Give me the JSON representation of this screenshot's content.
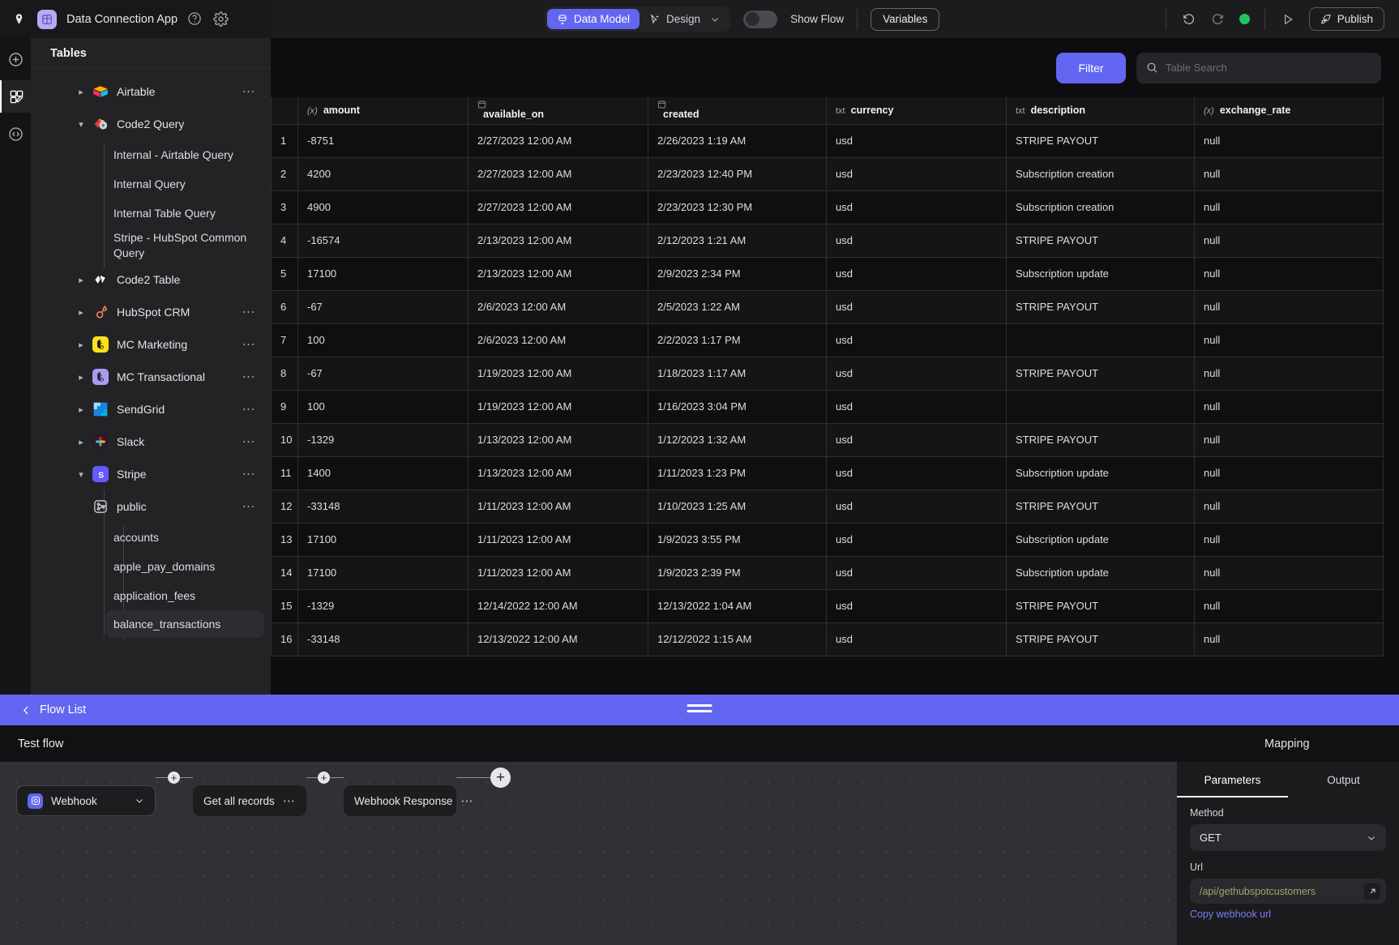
{
  "topbar": {
    "home_icon": "home-icon",
    "app_title": "Data Connection App",
    "help_icon": "help-circle-icon",
    "settings_icon": "gear-icon",
    "segment": {
      "data_model": "Data Model",
      "design": "Design",
      "caret": "chevron-down-icon"
    },
    "show_flow_label": "Show Flow",
    "show_flow_on": false,
    "variables_label": "Variables",
    "undo_icon": "undo-icon",
    "redo_icon": "redo-icon",
    "status_dot_color": "#22c55e",
    "play_icon": "play-icon",
    "publish_label": "Publish",
    "publish_icon": "rocket-icon"
  },
  "rail": {
    "items": [
      {
        "name": "add-icon"
      },
      {
        "name": "tables-edit-icon"
      },
      {
        "name": "code-icon"
      }
    ]
  },
  "sidebar": {
    "header": "Tables",
    "items": [
      {
        "label": "Airtable",
        "icon": "airtable-icon",
        "expanded": false,
        "dots": true
      },
      {
        "label": "Code2 Query",
        "icon": "code2-query-icon",
        "expanded": true,
        "dots": false,
        "children": [
          "Internal - Airtable Query",
          "Internal Query",
          "Internal Table Query",
          "Stripe - HubSpot Common Query"
        ]
      },
      {
        "label": "Code2 Table",
        "icon": "code2-table-icon",
        "expanded": false,
        "dots": false
      },
      {
        "label": "HubSpot CRM",
        "icon": "hubspot-icon",
        "expanded": false,
        "dots": true
      },
      {
        "label": "MC Marketing",
        "icon": "mailchimp-marketing-icon",
        "expanded": false,
        "dots": true
      },
      {
        "label": "MC Transactional",
        "icon": "mailchimp-transactional-icon",
        "expanded": false,
        "dots": true
      },
      {
        "label": "SendGrid",
        "icon": "sendgrid-icon",
        "expanded": false,
        "dots": true
      },
      {
        "label": "Slack",
        "icon": "slack-icon",
        "expanded": false,
        "dots": true
      },
      {
        "label": "Stripe",
        "icon": "stripe-icon",
        "expanded": true,
        "dots": true
      }
    ],
    "stripe_schema": {
      "label": "public",
      "icon": "schema-icon",
      "expanded": true,
      "dots": true
    },
    "stripe_tables": [
      "accounts",
      "apple_pay_domains",
      "application_fees",
      "balance_transactions"
    ],
    "selected_table": "balance_transactions"
  },
  "toolbar": {
    "filter_label": "Filter",
    "search_placeholder": "Table Search",
    "search_value": "",
    "search_icon": "search-icon"
  },
  "table": {
    "columns": [
      {
        "name": "amount",
        "type": "(x)",
        "type_kind": "number"
      },
      {
        "name": "available_on",
        "type": "date",
        "type_kind": "date"
      },
      {
        "name": "created",
        "type": "date",
        "type_kind": "date"
      },
      {
        "name": "currency",
        "type": "txt",
        "type_kind": "text"
      },
      {
        "name": "description",
        "type": "txt",
        "type_kind": "text"
      },
      {
        "name": "exchange_rate",
        "type": "(x)",
        "type_kind": "number"
      }
    ],
    "rows": [
      {
        "idx": "1",
        "amount": "-8751",
        "available_on": "2/27/2023 12:00 AM",
        "created": "2/26/2023 1:19 AM",
        "currency": "usd",
        "description": "STRIPE PAYOUT",
        "exchange_rate": "null"
      },
      {
        "idx": "2",
        "amount": "4200",
        "available_on": "2/27/2023 12:00 AM",
        "created": "2/23/2023 12:40 PM",
        "currency": "usd",
        "description": "Subscription creation",
        "exchange_rate": "null"
      },
      {
        "idx": "3",
        "amount": "4900",
        "available_on": "2/27/2023 12:00 AM",
        "created": "2/23/2023 12:30 PM",
        "currency": "usd",
        "description": "Subscription creation",
        "exchange_rate": "null"
      },
      {
        "idx": "4",
        "amount": "-16574",
        "available_on": "2/13/2023 12:00 AM",
        "created": "2/12/2023 1:21 AM",
        "currency": "usd",
        "description": "STRIPE PAYOUT",
        "exchange_rate": "null"
      },
      {
        "idx": "5",
        "amount": "17100",
        "available_on": "2/13/2023 12:00 AM",
        "created": "2/9/2023 2:34 PM",
        "currency": "usd",
        "description": "Subscription update",
        "exchange_rate": "null"
      },
      {
        "idx": "6",
        "amount": "-67",
        "available_on": "2/6/2023 12:00 AM",
        "created": "2/5/2023 1:22 AM",
        "currency": "usd",
        "description": "STRIPE PAYOUT",
        "exchange_rate": "null"
      },
      {
        "idx": "7",
        "amount": "100",
        "available_on": "2/6/2023 12:00 AM",
        "created": "2/2/2023 1:17 PM",
        "currency": "usd",
        "description": "",
        "exchange_rate": "null"
      },
      {
        "idx": "8",
        "amount": "-67",
        "available_on": "1/19/2023 12:00 AM",
        "created": "1/18/2023 1:17 AM",
        "currency": "usd",
        "description": "STRIPE PAYOUT",
        "exchange_rate": "null"
      },
      {
        "idx": "9",
        "amount": "100",
        "available_on": "1/19/2023 12:00 AM",
        "created": "1/16/2023 3:04 PM",
        "currency": "usd",
        "description": "",
        "exchange_rate": "null"
      },
      {
        "idx": "10",
        "amount": "-1329",
        "available_on": "1/13/2023 12:00 AM",
        "created": "1/12/2023 1:32 AM",
        "currency": "usd",
        "description": "STRIPE PAYOUT",
        "exchange_rate": "null"
      },
      {
        "idx": "11",
        "amount": "1400",
        "available_on": "1/13/2023 12:00 AM",
        "created": "1/11/2023 1:23 PM",
        "currency": "usd",
        "description": "Subscription update",
        "exchange_rate": "null"
      },
      {
        "idx": "12",
        "amount": "-33148",
        "available_on": "1/11/2023 12:00 AM",
        "created": "1/10/2023 1:25 AM",
        "currency": "usd",
        "description": "STRIPE PAYOUT",
        "exchange_rate": "null"
      },
      {
        "idx": "13",
        "amount": "17100",
        "available_on": "1/11/2023 12:00 AM",
        "created": "1/9/2023 3:55 PM",
        "currency": "usd",
        "description": "Subscription update",
        "exchange_rate": "null"
      },
      {
        "idx": "14",
        "amount": "17100",
        "available_on": "1/11/2023 12:00 AM",
        "created": "1/9/2023 2:39 PM",
        "currency": "usd",
        "description": "Subscription update",
        "exchange_rate": "null"
      },
      {
        "idx": "15",
        "amount": "-1329",
        "available_on": "12/14/2022 12:00 AM",
        "created": "12/13/2022 1:04 AM",
        "currency": "usd",
        "description": "STRIPE PAYOUT",
        "exchange_rate": "null"
      },
      {
        "idx": "16",
        "amount": "-33148",
        "available_on": "12/13/2022 12:00 AM",
        "created": "12/12/2022 1:15 AM",
        "currency": "usd",
        "description": "STRIPE PAYOUT",
        "exchange_rate": "null"
      }
    ]
  },
  "flow": {
    "bar_label": "Flow List",
    "back_icon": "chevron-left-icon",
    "grip_icon": "drag-handle-icon",
    "title": "Test flow",
    "mapping_label": "Mapping",
    "nodes": [
      {
        "label": "Webhook",
        "icon": "webhook-icon",
        "has_caret": true
      },
      {
        "label": "Get all records",
        "has_dots": true
      },
      {
        "label": "Webhook Response",
        "has_dots": true
      }
    ],
    "add_node_label": "+"
  },
  "params": {
    "tabs": [
      {
        "label": "Parameters",
        "active": true
      },
      {
        "label": "Output",
        "active": false
      }
    ],
    "method_label": "Method",
    "method_value": "GET",
    "url_label": "Url",
    "url_value": "/api/gethubspotcustomers",
    "expand_icon": "open-external-icon",
    "copy_link_label": "Copy webhook url"
  }
}
